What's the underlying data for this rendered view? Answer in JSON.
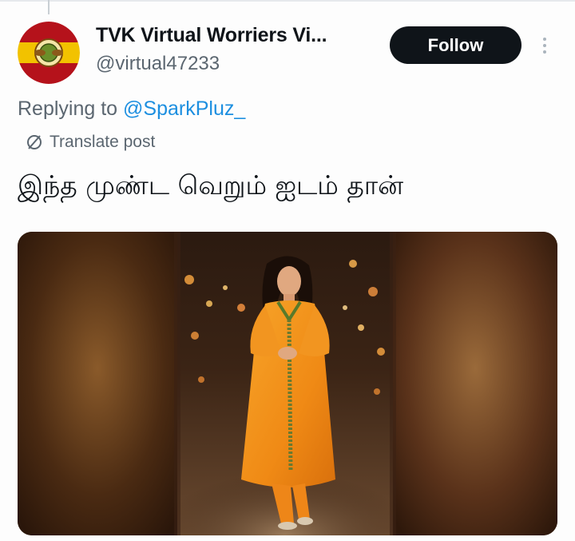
{
  "account": {
    "display_name": "TVK Virtual Worriers Vi...",
    "handle": "@virtual47233"
  },
  "actions": {
    "follow_label": "Follow",
    "more_icon": "more-vertical-icon"
  },
  "reply": {
    "prefix": "Replying to ",
    "to_handle": "@SparkPluz_"
  },
  "translate": {
    "label": "Translate post",
    "icon": "translate-icon"
  },
  "post": {
    "text": "இந்த முண்ட வெறும் ஐடம் தான்"
  },
  "colors": {
    "follow_bg": "#0f1419",
    "link": "#1d8fe0",
    "muted_text": "#5b6670",
    "avatar_red": "#c8102e",
    "avatar_yellow": "#f2c200"
  }
}
